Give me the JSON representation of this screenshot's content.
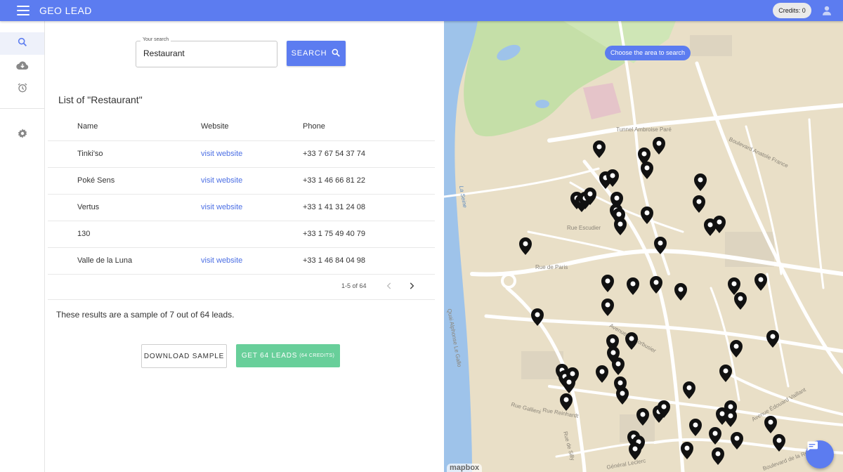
{
  "app": {
    "title": "GEO LEAD",
    "credits": "Credits: 0"
  },
  "sidebar": {
    "items": [
      {
        "icon": "search-icon"
      },
      {
        "icon": "cloud-download-icon"
      },
      {
        "icon": "alarm-clock-icon"
      },
      {
        "icon": "gear-icon"
      }
    ]
  },
  "search": {
    "legend": "Your search",
    "value": "Restaurant",
    "button_label": "SEARCH"
  },
  "list": {
    "title": "List of \"Restaurant\"",
    "columns": [
      "Name",
      "Website",
      "Phone"
    ],
    "rows": [
      {
        "name": "Tinki'so",
        "website": "visit website",
        "phone": "+33 7 67 54 37 74"
      },
      {
        "name": "Poké Sens",
        "website": "visit website",
        "phone": "+33 1 46 66 81 22"
      },
      {
        "name": "Vertus",
        "website": "visit website",
        "phone": "+33 1 41 31 24 08"
      },
      {
        "name": "130",
        "website": "",
        "phone": "+33 1 75 49 40 79"
      },
      {
        "name": "Valle de la Luna",
        "website": "visit website",
        "phone": "+33 1 46 84 04 98"
      }
    ],
    "pagination": "1-5 of 64"
  },
  "sample_note": "These results are a sample of 7 out of 64 leads.",
  "actions": {
    "download_label": "DOWNLOAD SAMPLE",
    "get_leads_label": "GET 64 LEADS",
    "get_leads_sub": "(64 CREDITS)"
  },
  "map": {
    "tooltip": "Choose the area to search",
    "attribution": "mapbox",
    "labels": {
      "tunnel": "Tunnel Ambroise Paré",
      "seine": "La Seine",
      "rue_escudier": "Rue Escudier",
      "rue_de_paris": "Rue de Paris",
      "boulevard_anatole_france": "Boulevard Anatole France",
      "avenue_le_corbusier": "Avenue Le Corbusier",
      "rue_gallieni": "Rue Gallieni",
      "rue_reinhardt": "Rue Reinhardt",
      "avenue_edouard_vaillant": "Avenue Édouard Vaillant",
      "boulevard_de_la_republique": "Boulevard de la République",
      "rue_de_silly": "Rue de Silly",
      "general_leclerc": "Général Leclerc",
      "quai_le_gallo": "Quai Alphonse Le Gallo"
    }
  },
  "colors": {
    "primary": "#5c7cf0",
    "success": "#68cf9a",
    "link": "#4c6fe4",
    "map_park": "#c5dfa8",
    "map_water": "#9ec3ea",
    "map_land": "#e9dfc7"
  }
}
